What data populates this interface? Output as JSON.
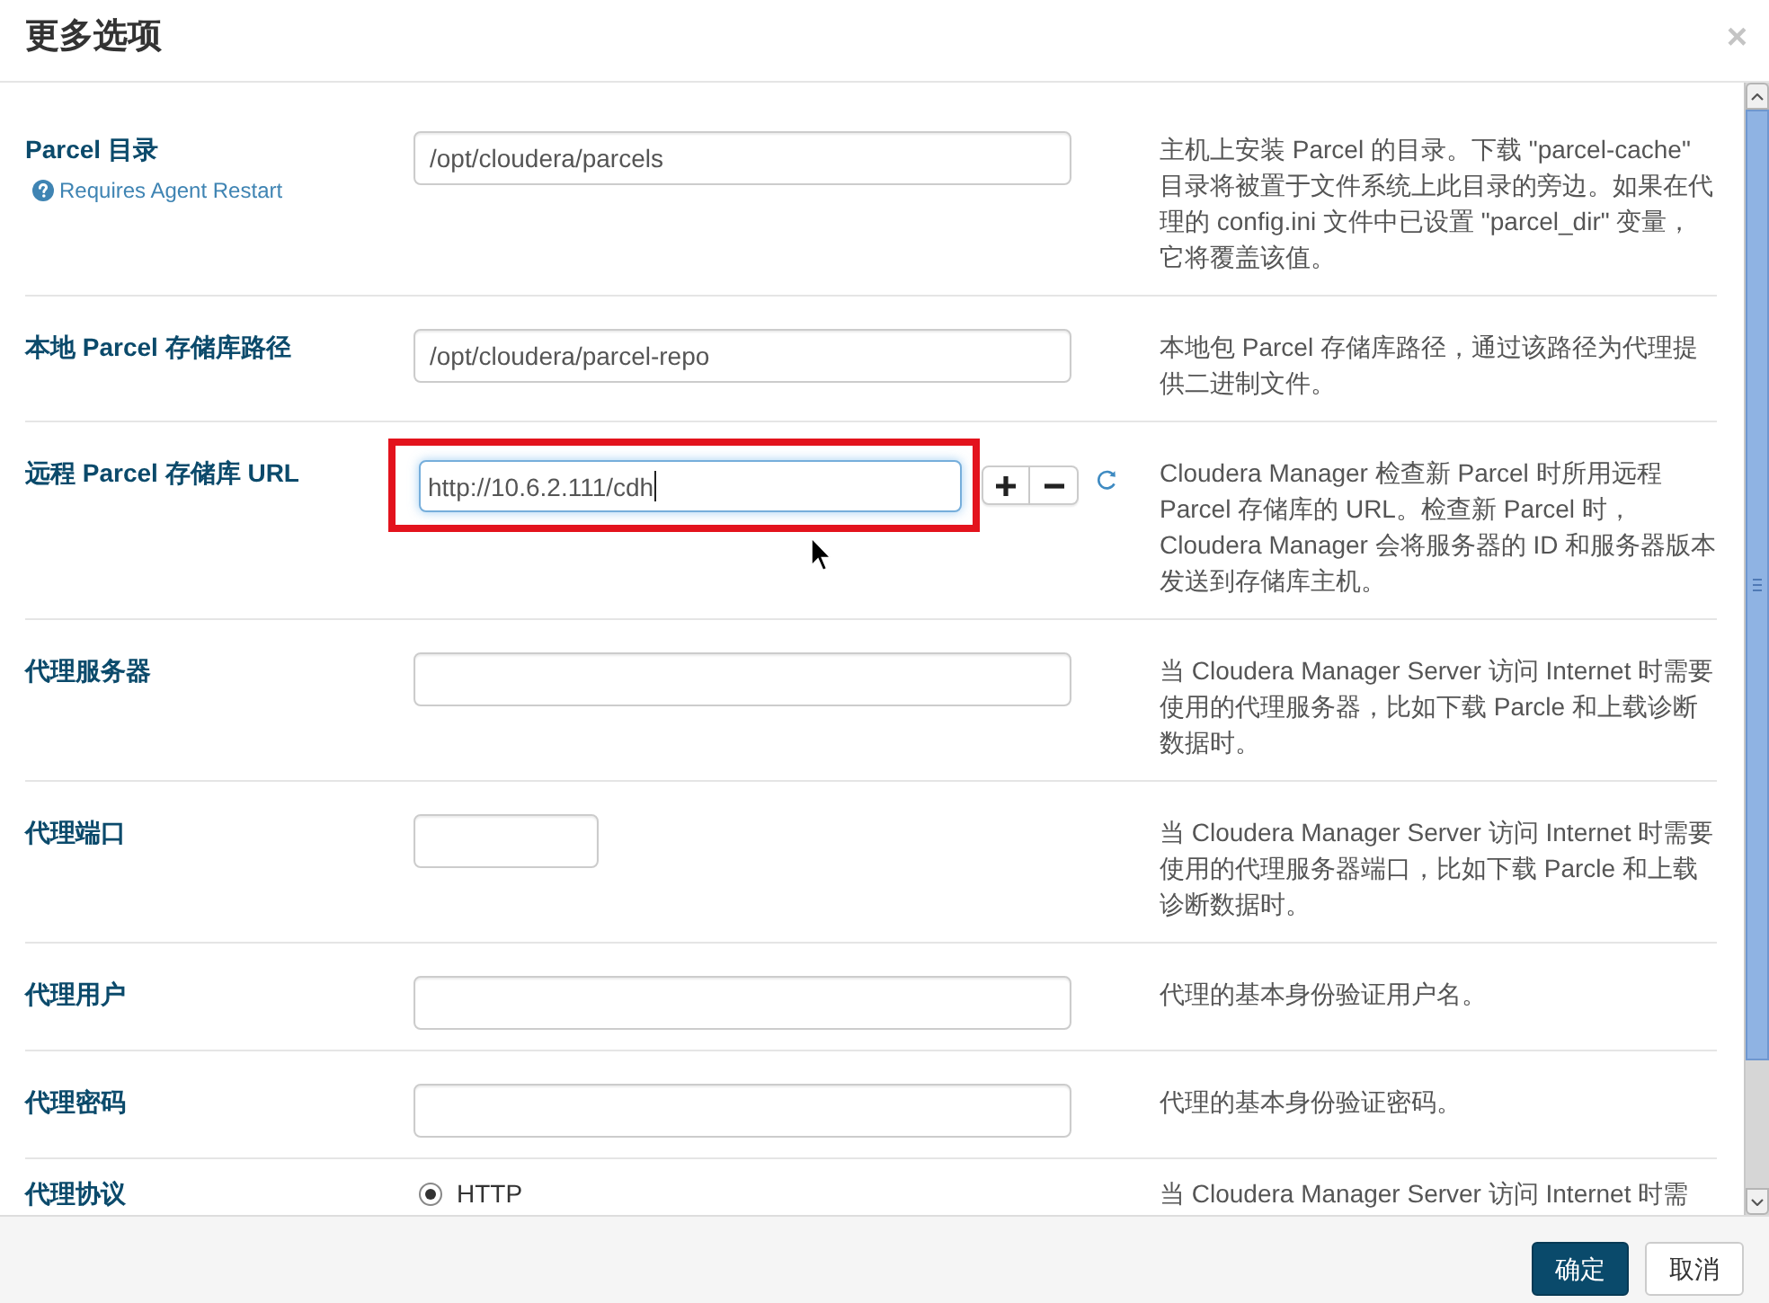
{
  "dialog": {
    "title": "更多选项",
    "close": "×"
  },
  "settings": [
    {
      "kind": "text",
      "label": "Parcel 目录",
      "note": "Requires Agent Restart",
      "value": "/opt/cloudera/parcels",
      "description": "主机上安装 Parcel 的目录。下载 \"parcel-cache\" 目录将被置于文件系统上此目录的旁边。如果在代理的 config.ini 文件中已设置 \"parcel_dir\" 变量，它将覆盖该值。"
    },
    {
      "kind": "text",
      "label": "本地 Parcel 存储库路径",
      "value": "/opt/cloudera/parcel-repo",
      "description": "本地包 Parcel 存储库路径，通过该路径为代理提供二进制文件。"
    },
    {
      "kind": "multi",
      "label": "远程 Parcel 存储库 URL",
      "values": [
        {
          "value": "http://10.6.2.111/cdh",
          "focused": true,
          "highlighted": true
        }
      ],
      "description": "Cloudera Manager 检查新 Parcel 时所用远程 Parcel 存储库的 URL。检查新 Parcel 时，Cloudera Manager 会将服务器的 ID 和服务器版本发送到存储库主机。"
    },
    {
      "kind": "text",
      "label": "代理服务器",
      "description": "当 Cloudera Manager Server 访问 Internet 时需要使用的代理服务器，比如下载 Parcle 和上载诊断数据时。"
    },
    {
      "kind": "port",
      "label": "代理端口",
      "description": "当 Cloudera Manager Server 访问 Internet 时需要使用的代理服务器端口，比如下载 Parcle 和上载诊断数据时。"
    },
    {
      "kind": "text",
      "label": "代理用户",
      "description": "代理的基本身份验证用户名。"
    },
    {
      "kind": "password",
      "label": "代理密码",
      "description": "代理的基本身份验证密码。"
    },
    {
      "kind": "radio",
      "label": "代理协议",
      "options": [
        {
          "label": "HTTP",
          "selected": true
        }
      ],
      "description": "当 Cloudera Manager Server 访问 Internet 时需"
    }
  ],
  "buttons": [
    {
      "kind": "primary",
      "label": "确定"
    },
    {
      "kind": "default",
      "label": "取消"
    }
  ]
}
